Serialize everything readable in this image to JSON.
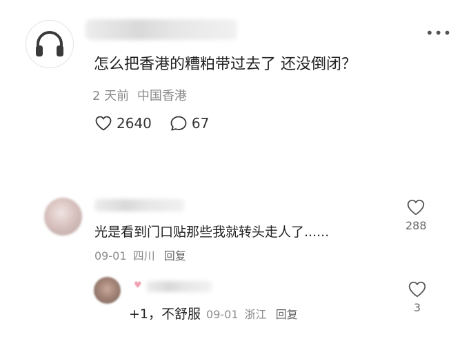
{
  "post": {
    "text": "怎么把香港的糟粕带过去了 还没倒闭？",
    "time": "2 天前",
    "location": "中国香港",
    "likes": "2640",
    "comments": "67",
    "more_icon": "more-horizontal-icon",
    "avatar_icon": "headphones-icon"
  },
  "comments": [
    {
      "text": "光是看到门口贴那些我就转头走人了......",
      "date": "09-01",
      "location": "四川",
      "reply_label": "回复",
      "likes": "288"
    }
  ],
  "replies": [
    {
      "text": "+1，不舒服",
      "date": "09-01",
      "location": "浙江",
      "reply_label": "回复",
      "likes": "3"
    }
  ],
  "colors": {
    "text": "#222222",
    "meta": "#8a8a8a",
    "icon": "#333333"
  }
}
